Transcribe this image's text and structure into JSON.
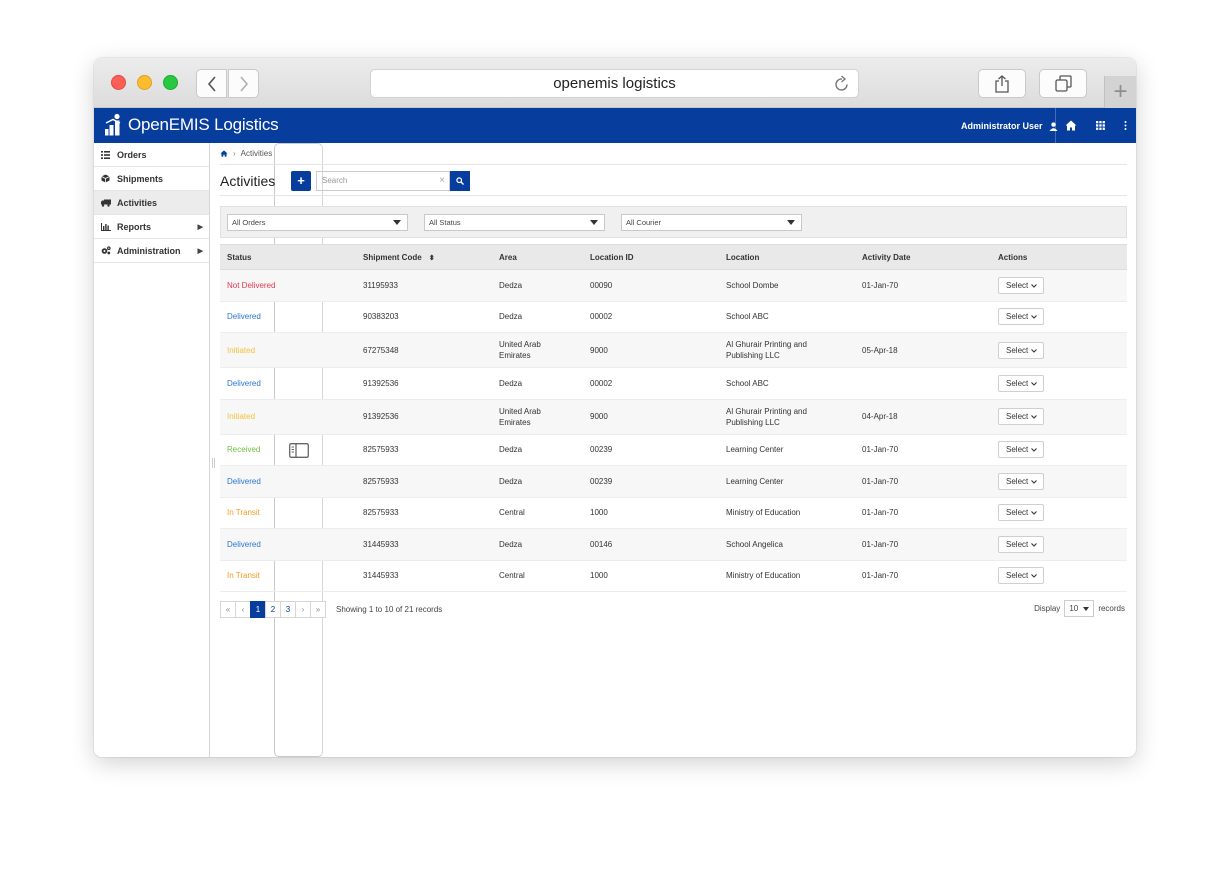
{
  "browser": {
    "url": "openemis logistics",
    "new_tab_label": "+"
  },
  "header": {
    "title": "OpenEMIS Logistics",
    "user": "Administrator User",
    "accent_color": "#073d9c"
  },
  "sidebar": {
    "items": [
      {
        "label": "Orders",
        "icon": "list-icon"
      },
      {
        "label": "Shipments",
        "icon": "cube-icon"
      },
      {
        "label": "Activities",
        "icon": "truck-icon",
        "active": true
      },
      {
        "label": "Reports",
        "icon": "bar-chart-icon",
        "has_submenu": true
      },
      {
        "label": "Administration",
        "icon": "cogs-icon",
        "has_submenu": true
      }
    ]
  },
  "breadcrumb": {
    "separator": "›",
    "current": "Activities"
  },
  "toolbar": {
    "title": "Activities",
    "add_label": "+",
    "search_placeholder": "Search",
    "clear_label": "×"
  },
  "filters": {
    "orders": "All Orders",
    "status": "All Status",
    "courier": "All Courier"
  },
  "table": {
    "columns": [
      "Status",
      "Shipment Code",
      "Area",
      "Location ID",
      "Location",
      "Activity Date",
      "Actions"
    ],
    "rows": [
      {
        "status": "Not Delivered",
        "code": "31195933",
        "area": "Dedza",
        "location_id": "00090",
        "location": "School Dombe",
        "date": "01-Jan-70",
        "action": "Select"
      },
      {
        "status": "Delivered",
        "code": "90383203",
        "area": "Dedza",
        "location_id": "00002",
        "location": "School ABC",
        "date": "",
        "action": "Select"
      },
      {
        "status": "Initiated",
        "code": "67275348",
        "area": "United Arab Emirates",
        "location_id": "9000",
        "location": "Al Ghurair Printing and Publishing LLC",
        "date": "05-Apr-18",
        "action": "Select"
      },
      {
        "status": "Delivered",
        "code": "91392536",
        "area": "Dedza",
        "location_id": "00002",
        "location": "School ABC",
        "date": "",
        "action": "Select"
      },
      {
        "status": "Initiated",
        "code": "91392536",
        "area": "United Arab Emirates",
        "location_id": "9000",
        "location": "Al Ghurair Printing and Publishing LLC",
        "date": "04-Apr-18",
        "action": "Select"
      },
      {
        "status": "Received",
        "code": "82575933",
        "area": "Dedza",
        "location_id": "00239",
        "location": "Learning Center",
        "date": "01-Jan-70",
        "action": "Select"
      },
      {
        "status": "Delivered",
        "code": "82575933",
        "area": "Dedza",
        "location_id": "00239",
        "location": "Learning Center",
        "date": "01-Jan-70",
        "action": "Select"
      },
      {
        "status": "In Transit",
        "code": "82575933",
        "area": "Central",
        "location_id": "1000",
        "location": "Ministry of Education",
        "date": "01-Jan-70",
        "action": "Select"
      },
      {
        "status": "Delivered",
        "code": "31445933",
        "area": "Dedza",
        "location_id": "00146",
        "location": "School Angelica",
        "date": "01-Jan-70",
        "action": "Select"
      },
      {
        "status": "In Transit",
        "code": "31445933",
        "area": "Central",
        "location_id": "1000",
        "location": "Ministry of Education",
        "date": "01-Jan-70",
        "action": "Select"
      }
    ]
  },
  "pagination": {
    "first": "«",
    "prev": "‹",
    "pages": [
      "1",
      "2",
      "3"
    ],
    "current_page": "1",
    "next": "›",
    "last": "»",
    "showing": "Showing 1 to 10 of 21 records",
    "display_label": "Display",
    "display_value": "10",
    "records_label": "records"
  },
  "status_colors": {
    "Not Delivered": "#e8384f",
    "Delivered": "#2b76d0",
    "Initiated": "#f0c33b",
    "Received": "#72bf44",
    "In Transit": "#f39c21"
  }
}
